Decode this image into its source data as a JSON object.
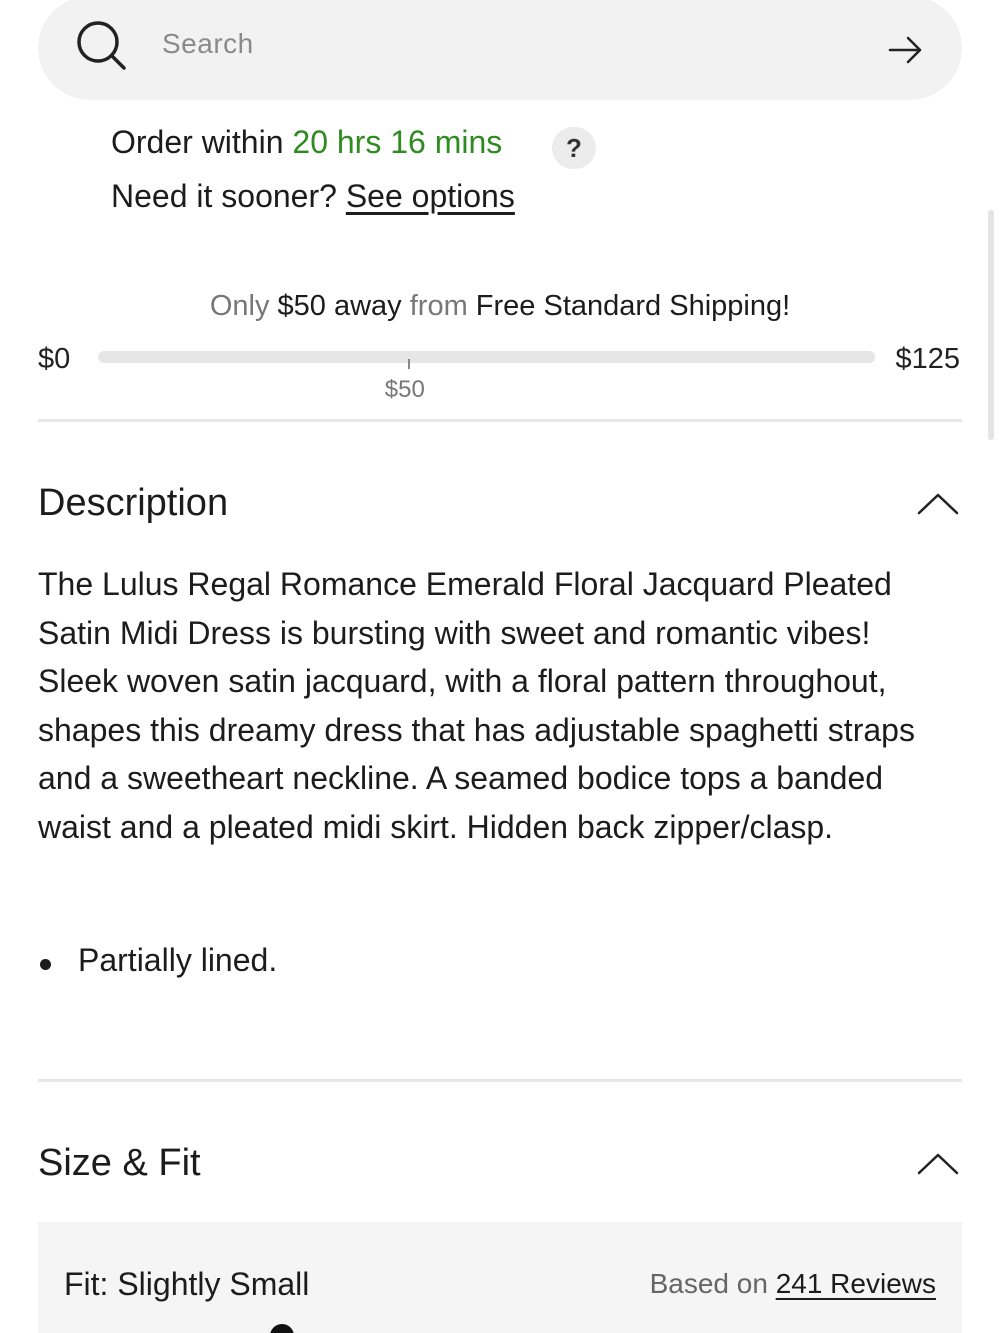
{
  "search": {
    "placeholder": "Search",
    "icon": "search-icon",
    "submit_icon": "arrow-right-icon"
  },
  "delivery": {
    "order_prefix": "Order within ",
    "order_time": "20 hrs 16 mins",
    "help_label": "?",
    "sooner_prefix": "Need it sooner? ",
    "see_options": "See options",
    "accent_color": "#2e8b1f"
  },
  "shipping": {
    "msg_only": "Only ",
    "msg_amount": "$50 away",
    "msg_from": " from ",
    "msg_target": "Free Standard Shipping!",
    "min_label": "$0",
    "max_label": "$125",
    "tick_label": "$50",
    "min_value": 0,
    "max_value": 125,
    "tick_value": 50
  },
  "description": {
    "title": "Description",
    "body": "The Lulus Regal Romance Emerald Floral Jacquard Pleated Satin Midi Dress is bursting with sweet and romantic vibes! Sleek woven satin jacquard, with a floral pattern throughout, shapes this dreamy dress that has adjustable spaghetti straps and a sweetheart neckline. A seamed bodice tops a banded waist and a pleated midi skirt. Hidden back zipper/clasp.",
    "bullets": [
      "Partially lined."
    ]
  },
  "size_fit": {
    "title": "Size & Fit",
    "fit_label": "Fit: Slightly Small",
    "based_on": "Based on ",
    "reviews_link": "241 Reviews"
  }
}
